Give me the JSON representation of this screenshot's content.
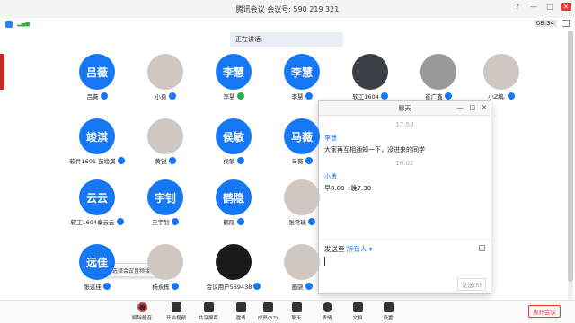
{
  "window": {
    "title": "腾讯会议 会议号: 590 219 321",
    "controls": [
      "?",
      "—",
      "□",
      "✕"
    ]
  },
  "infobar": {
    "clock": "08:34"
  },
  "speaking_label": "正在讲话:",
  "participants": [
    {
      "avatar_text": "吕薇",
      "name": "吕薇",
      "photo": false
    },
    {
      "avatar_text": "",
      "name": "小勇",
      "photo": true,
      "style": "ink"
    },
    {
      "avatar_text": "李慧",
      "name": "李慧",
      "photo": false,
      "mic": "green"
    },
    {
      "avatar_text": "李慧",
      "name": "李慧",
      "photo": false
    },
    {
      "avatar_text": "",
      "name": "软工1604",
      "photo": true,
      "style": "dark"
    },
    {
      "avatar_text": "",
      "name": "崔广鑫",
      "photo": true,
      "style": "cat"
    },
    {
      "avatar_text": "",
      "name": "小Z編.",
      "photo": true,
      "style": "ink"
    },
    {
      "avatar_text": "竣淇",
      "name": "软件1601 苗竣淇",
      "photo": false
    },
    {
      "avatar_text": "",
      "name": "黄锐",
      "photo": true,
      "style": "ink"
    },
    {
      "avatar_text": "侯敏",
      "name": "侯敏",
      "photo": false
    },
    {
      "avatar_text": "马薇",
      "name": "马薇",
      "photo": false
    },
    {
      "avatar_text": "云云",
      "name": "软工1604秦云云",
      "photo": false
    },
    {
      "avatar_text": "宇钊",
      "name": "王宇钊",
      "photo": false
    },
    {
      "avatar_text": "鹤隐",
      "name": "鹤隐",
      "photo": false
    },
    {
      "avatar_text": "",
      "name": "张常瑞",
      "photo": true,
      "style": "ink"
    },
    {
      "avatar_text": "远佳",
      "name": "张远佳",
      "photo": false
    },
    {
      "avatar_text": "",
      "name": "杨永栋",
      "photo": true,
      "style": "ink"
    },
    {
      "avatar_text": "",
      "name": "会议用户569438",
      "photo": true,
      "style": "mickey"
    },
    {
      "avatar_text": "",
      "name": "画骁",
      "photo": true,
      "style": "ink"
    }
  ],
  "tooltip": "请选择会议音频接入方式",
  "chat": {
    "title": "聊天",
    "controls": [
      "—",
      "□",
      "✕"
    ],
    "time1": "17:58",
    "sender1": "李慧",
    "msg1": "大家再互相通知一下，没进来的同学",
    "time2": "18:02",
    "sender2": "小勇",
    "msg2": "早8.00 - 晚7.30",
    "send_to_label": "发送至",
    "send_to_target": "所有人",
    "send_button": "发送(S)"
  },
  "toolbar": {
    "items": [
      "解除静音",
      "开启视频",
      "共享屏幕",
      "邀请",
      "成员(52)",
      "聊天",
      "表情",
      "文档",
      "设置"
    ],
    "leave": "离开会议"
  }
}
